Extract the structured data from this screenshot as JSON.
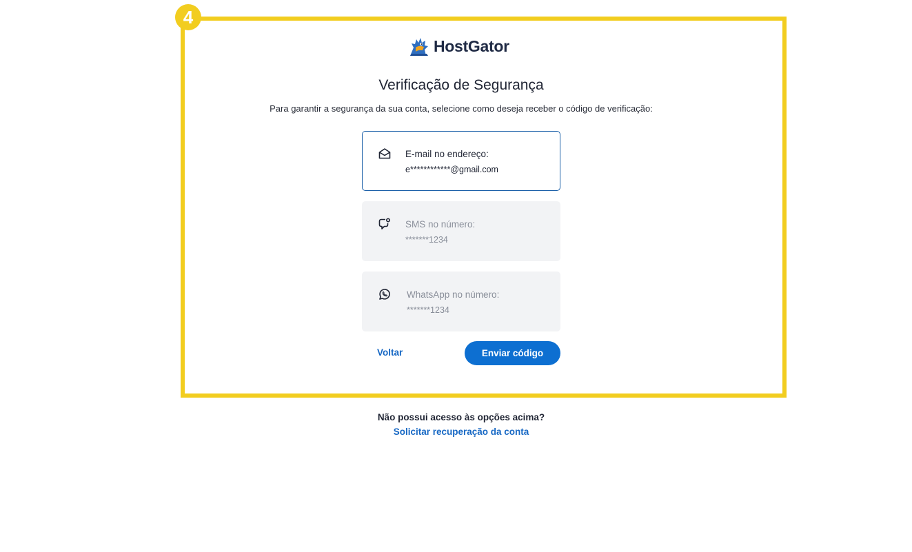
{
  "step_badge": "4",
  "brand": {
    "name": "HostGator",
    "logo_icon": "gator-mascot-icon"
  },
  "title": "Verificação de Segurança",
  "subtitle": "Para garantir a segurança da sua conta, selecione como deseja receber o código de verificação:",
  "options": [
    {
      "icon": "envelope-open-icon",
      "label": "E-mail no endereço:",
      "value": "e************@gmail.com",
      "selected": true
    },
    {
      "icon": "chat-bubble-dot-icon",
      "label": "SMS no número:",
      "value": "*******1234",
      "selected": false
    },
    {
      "icon": "whatsapp-icon",
      "label": "WhatsApp no número:",
      "value": "*******1234",
      "selected": false
    }
  ],
  "actions": {
    "back_label": "Voltar",
    "send_label": "Enviar código"
  },
  "help": {
    "question": "Não possui acesso às opções acima?",
    "link_label": "Solicitar recuperação da conta"
  },
  "colors": {
    "highlight": "#f2cd1f",
    "primary": "#0d6fd1",
    "link": "#1768c4",
    "selected_border": "#1a5fa8",
    "card_bg": "#f2f3f5"
  }
}
